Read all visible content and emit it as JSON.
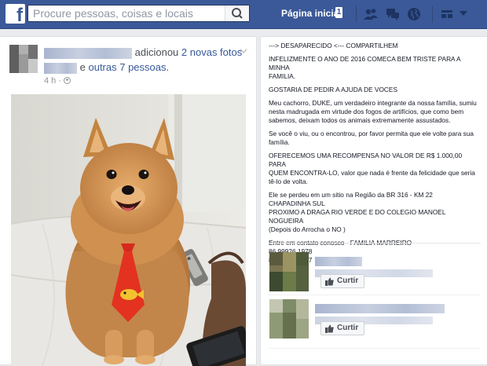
{
  "topbar": {
    "logo": "f",
    "search_placeholder": "Procure pessoas, coisas e locais",
    "home_label": "Página inicial",
    "home_count": "1",
    "icons": [
      "friends-icon",
      "messages-icon",
      "globe-icon",
      "settings-icon",
      "chevron-down-icon"
    ]
  },
  "post": {
    "action": "adicionou",
    "photos_link": "2 novas fotos",
    "conj": "e",
    "people_link": "outras 7 pessoas",
    "period": ".",
    "time": "4 h",
    "privacy_icon": "friends-audience-icon"
  },
  "description": {
    "paragraphs": [
      [
        "---> DESAPARECIDO <--- COMPARTILHEM"
      ],
      [
        "INFELIZMENTE O ANO DE 2016 COMECA BEM TRISTE PARA A MINHA",
        "FAMILIA."
      ],
      [
        "GOSTARIA DE PEDIR A AJUDA DE VOCES"
      ],
      [
        "Meu cachorro, DUKE, um verdadeiro integrante da nossa família, sumiu",
        "nesta madrugada em virtude dos fogos de artifícios, que como bem",
        "sabemos, deixam todos os animais extremamente assustados."
      ],
      [
        "Se você o viu, ou o encontrou, por favor permita que ele volte para sua",
        "família."
      ],
      [
        "OFERECEMOS UMA RECOMPENSA NO VALOR DE R$ 1.000,00 PARA",
        "QUEM ENCONTRA-LO, valor que nada é frente da felicidade que seria",
        "tê-lo de volta."
      ],
      [
        "Ele se perdeu em um sitio na Região da BR 316 - KM 22",
        "CHAPADINHA SUL",
        "PROXIMO A DRAGA RIO VERDE E DO COLEGIO MANOEL NOGUEIRA",
        "(Depois do Arrocha o NO )"
      ],
      [
        "Entre em contato conosco - FAMILIA MARREIRO",
        "86 99926 1978",
        "86 99922 6477"
      ]
    ]
  },
  "suggestions": [
    {
      "like_label": "Curtir"
    },
    {
      "like_label": "Curtir"
    }
  ],
  "colors": {
    "brand": "#3b5998",
    "link": "#365899"
  }
}
